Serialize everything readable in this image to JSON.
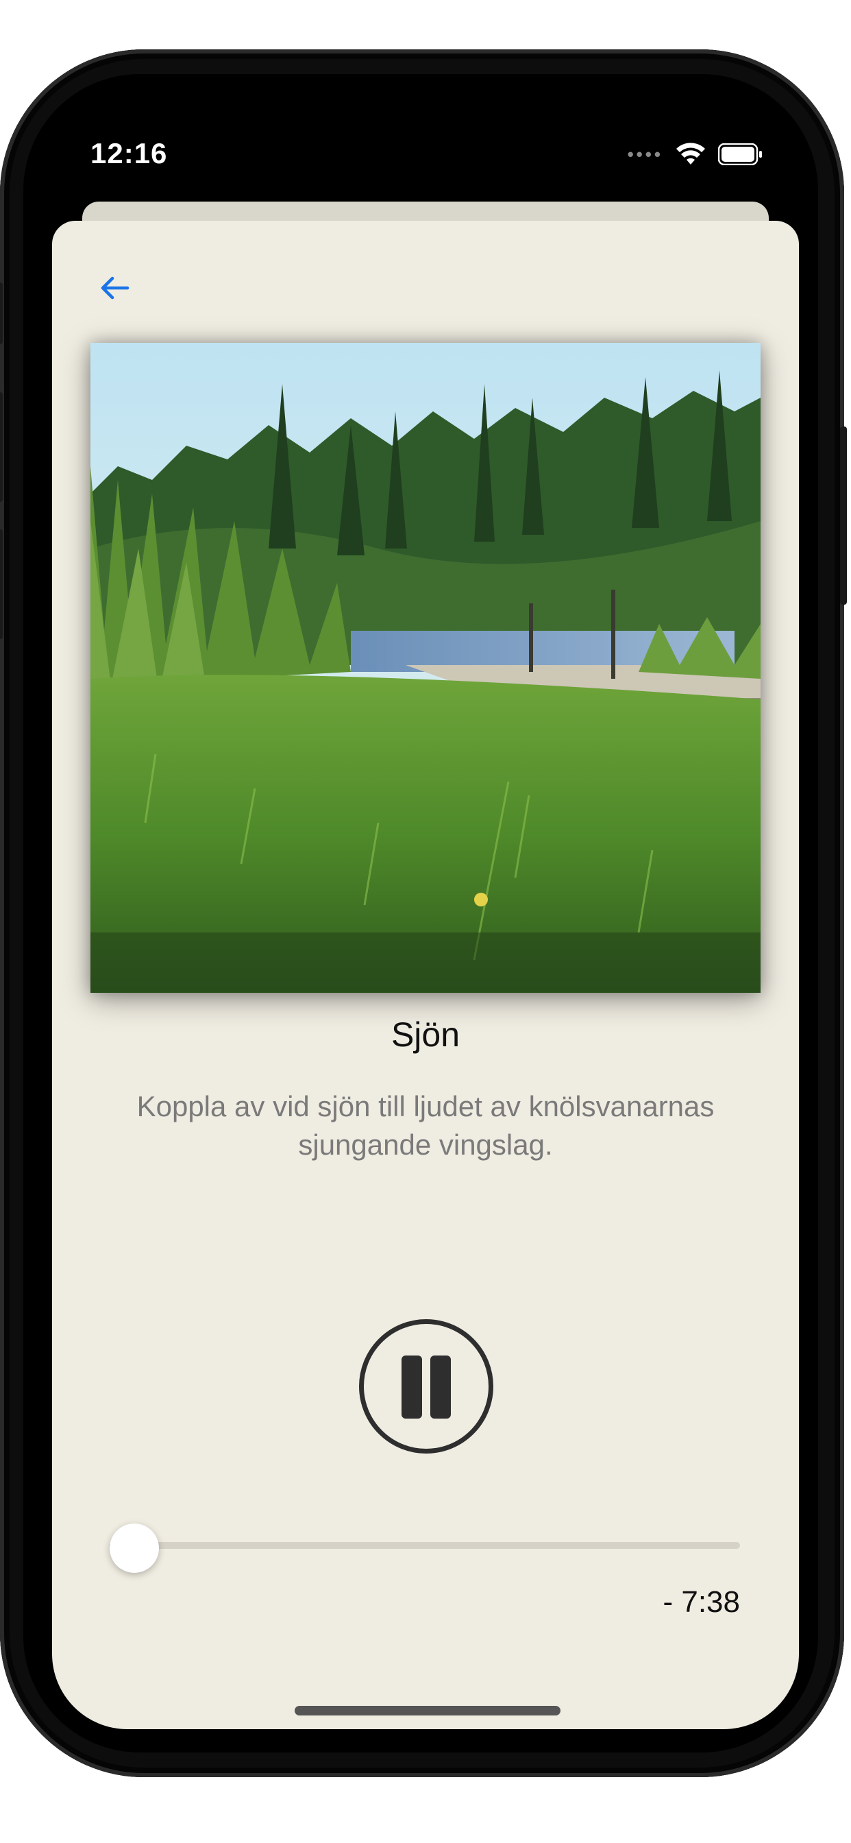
{
  "status_bar": {
    "time": "12:16",
    "signal_icon": "signal-dots-icon",
    "wifi_icon": "wifi-icon",
    "battery_icon": "battery-icon"
  },
  "nav": {
    "back_icon": "arrow-left-icon"
  },
  "track": {
    "title": "Sjön",
    "description": "Koppla av vid sjön till ljudet av knölsvanarnas sjungande vingslag.",
    "remaining": "- 7:38",
    "progress_fraction": 0.03
  },
  "controls": {
    "play_pause_icon": "pause-icon"
  },
  "colors": {
    "sheet_bg": "#efece1",
    "accent": "#1a73e8",
    "control": "#2e2e2e"
  }
}
